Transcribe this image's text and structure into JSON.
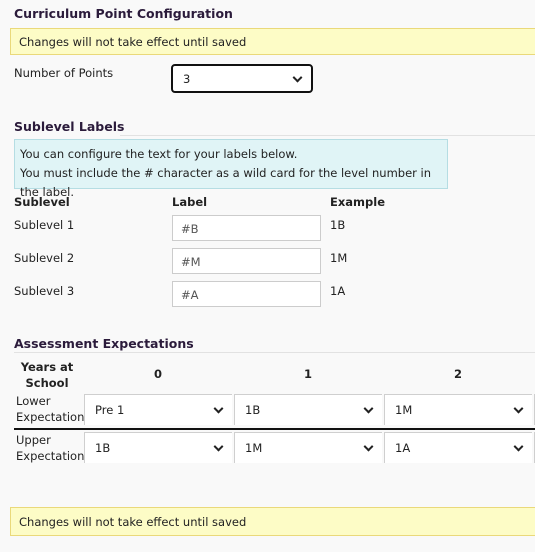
{
  "title": "Curriculum Point Configuration",
  "warning": "Changes will not take effect until saved",
  "points": {
    "label": "Number of Points",
    "value": "3"
  },
  "sublevels": {
    "heading": "Sublevel Labels",
    "info": [
      "You can configure the text for your labels below.",
      "You must include the # character as a wild card for the level number in the label."
    ],
    "headers": [
      "Sublevel",
      "Label",
      "Example"
    ],
    "rows": [
      {
        "name": "Sublevel 1",
        "label": "#B",
        "example": "1B"
      },
      {
        "name": "Sublevel 2",
        "label": "#M",
        "example": "1M"
      },
      {
        "name": "Sublevel 3",
        "label": "#A",
        "example": "1A"
      }
    ]
  },
  "assessment": {
    "heading": "Assessment Expectations",
    "years_header": "Years at School",
    "years": [
      "0",
      "1",
      "2"
    ],
    "lower": {
      "label": "Lower Expectation",
      "values": [
        "Pre 1",
        "1B",
        "1M"
      ]
    },
    "upper": {
      "label": "Upper Expectation",
      "values": [
        "1B",
        "1M",
        "1A"
      ]
    }
  },
  "bottom_warning": "Changes will not take effect until saved"
}
